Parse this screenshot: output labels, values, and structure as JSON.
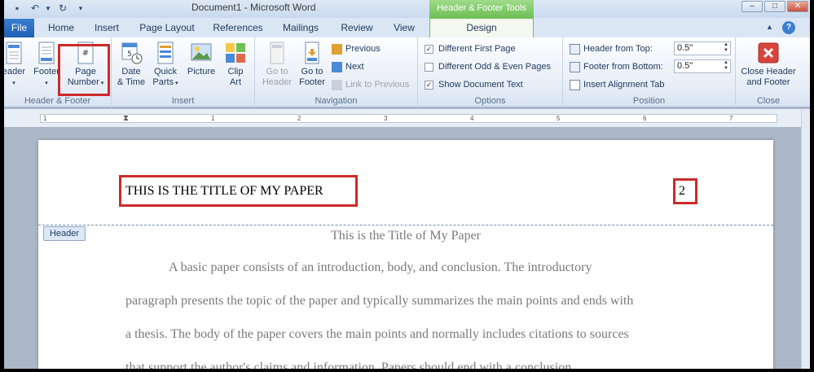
{
  "window": {
    "doc_title": "Document1 - Microsoft Word",
    "context_tab_title": "Header & Footer Tools"
  },
  "tabs": {
    "file": "File",
    "home": "Home",
    "insert": "Insert",
    "page_layout": "Page Layout",
    "references": "References",
    "mailings": "Mailings",
    "review": "Review",
    "view": "View",
    "design": "Design"
  },
  "ribbon": {
    "header_footer": {
      "label": "Header & Footer",
      "header": "eader",
      "footer": "Footer",
      "page_number_line1": "Page",
      "page_number_line2": "Number"
    },
    "insert": {
      "label": "Insert",
      "date_time_line1": "Date",
      "date_time_line2": "& Time",
      "quick_parts_line1": "Quick",
      "quick_parts_line2": "Parts",
      "picture": "Picture",
      "clip_art_line1": "Clip",
      "clip_art_line2": "Art"
    },
    "navigation": {
      "label": "Navigation",
      "go_to_header_line1": "Go to",
      "go_to_header_line2": "Header",
      "go_to_footer_line1": "Go to",
      "go_to_footer_line2": "Footer",
      "previous": "Previous",
      "next": "Next",
      "link_to_previous": "Link to Previous"
    },
    "options": {
      "label": "Options",
      "different_first_page": "Different First Page",
      "different_odd_even": "Different Odd & Even Pages",
      "show_document_text": "Show Document Text"
    },
    "position": {
      "label": "Position",
      "header_from_top": "Header from Top:",
      "header_from_top_value": "0.5\"",
      "footer_from_bottom": "Footer from Bottom:",
      "footer_from_bottom_value": "0.5\"",
      "insert_alignment_tab": "Insert Alignment Tab"
    },
    "close": {
      "label": "Close",
      "close_line1": "Close Header",
      "close_line2": "and Footer"
    }
  },
  "ruler": {
    "numbers": [
      "1",
      "1",
      "2",
      "3",
      "4",
      "5",
      "6",
      "7"
    ]
  },
  "document": {
    "header_title": "THIS IS THE TITLE OF MY PAPER",
    "page_number": "2",
    "header_tag": "Header",
    "body_title": "This is the Title of My Paper",
    "body_lines": [
      "A basic paper consists of an introduction, body, and conclusion. The introductory",
      "paragraph presents the topic of the paper and typically summarizes the main points and ends with",
      "a thesis. The body of the paper covers the main points and normally includes citations to sources",
      "that support the author's claims and information. Papers should end with a conclusion."
    ]
  },
  "colors": {
    "highlight_box": "#cc2a2a",
    "context_tab": "#6fbf55"
  }
}
